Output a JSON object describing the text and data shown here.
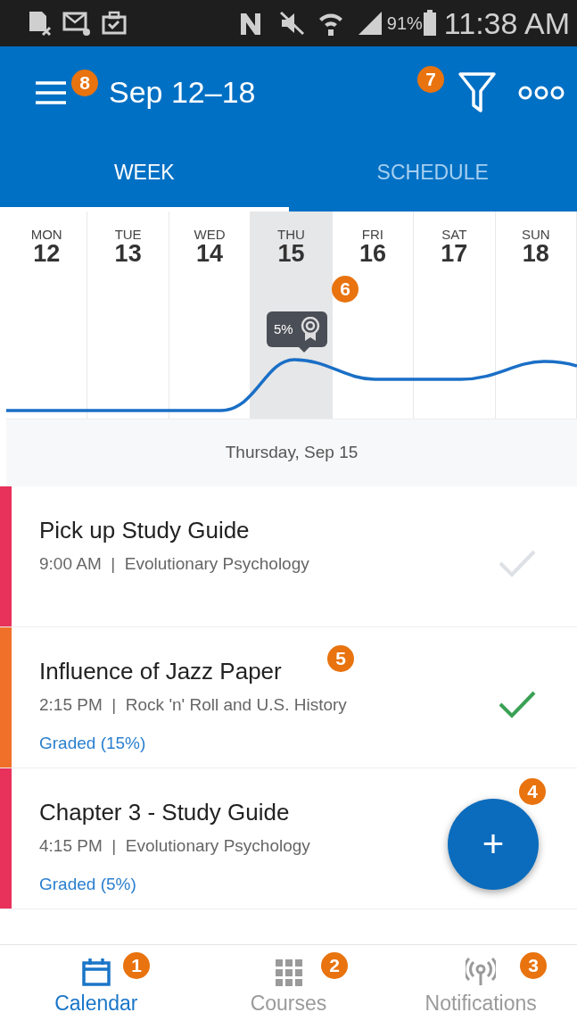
{
  "status_bar": {
    "battery": "91%",
    "time": "11:38 AM"
  },
  "app_bar": {
    "title": "Sep 12–18",
    "menu_callout": "8",
    "filter_callout": "7"
  },
  "tabs": [
    {
      "label": "WEEK",
      "selected": true
    },
    {
      "label": "SCHEDULE",
      "selected": false
    }
  ],
  "week": {
    "days": [
      {
        "weekday": "MON",
        "date": "12",
        "selected": false
      },
      {
        "weekday": "TUE",
        "date": "13",
        "selected": false
      },
      {
        "weekday": "WED",
        "date": "14",
        "selected": false
      },
      {
        "weekday": "THU",
        "date": "15",
        "selected": true
      },
      {
        "weekday": "FRI",
        "date": "16",
        "selected": false
      },
      {
        "weekday": "SAT",
        "date": "17",
        "selected": false
      },
      {
        "weekday": "SUN",
        "date": "18",
        "selected": false
      }
    ],
    "tooltip": "5%",
    "callout": "6"
  },
  "day_header": "Thursday, Sep 15",
  "events": [
    {
      "title": "Pick up Study Guide",
      "details": "9:00 AM  |  Evolutionary Psychology",
      "color": "#e8315b",
      "checked": false
    },
    {
      "title": "Influence of Jazz Paper",
      "details": "2:15 PM  |  Rock 'n' Roll and U.S. History",
      "color": "#f0702a",
      "checked": true,
      "graded": "Graded (15%)",
      "callout": "5"
    },
    {
      "title": "Chapter 3 - Study Guide",
      "details": "4:15 PM  |  Evolutionary Psychology",
      "color": "#e8315b",
      "graded": "Graded (5%)"
    }
  ],
  "fab": {
    "label": "+",
    "callout": "4"
  },
  "bottom_nav": [
    {
      "label": "Calendar",
      "selected": true,
      "callout": "1"
    },
    {
      "label": "Courses",
      "selected": false,
      "callout": "2"
    },
    {
      "label": "Notifications",
      "selected": false,
      "callout": "3"
    }
  ]
}
